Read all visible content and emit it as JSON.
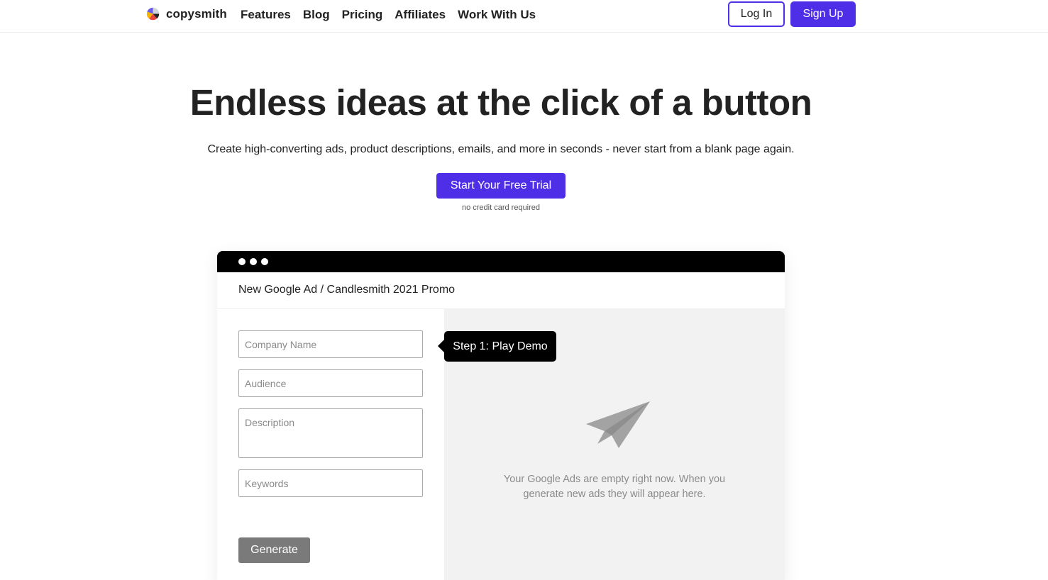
{
  "nav": {
    "logo_text": "copysmith",
    "links": [
      "Features",
      "Blog",
      "Pricing",
      "Affiliates",
      "Work With Us"
    ],
    "login_label": "Log In",
    "signup_label": "Sign Up"
  },
  "hero": {
    "title": "Endless ideas at the click of a button",
    "subtitle": "Create high-converting ads, product descriptions, emails, and more in seconds - never start from a blank page again.",
    "cta_label": "Start Your Free Trial",
    "cta_note": "no credit card required"
  },
  "demo": {
    "breadcrumb": "New Google Ad / Candlesmith 2021 Promo",
    "fields": {
      "company_placeholder": "Company Name",
      "audience_placeholder": "Audience",
      "description_placeholder": "Description",
      "keywords_placeholder": "Keywords"
    },
    "generate_label": "Generate",
    "empty_message": "Your Google Ads are empty right now. When you generate new ads they will appear here.",
    "tooltip": "Step 1: Play Demo"
  },
  "colors": {
    "accent": "#4f2ee8",
    "text": "#222222",
    "muted": "#8a8a8a",
    "panel_bg": "#f2f2f2",
    "generate_bg": "#7a7a7a"
  },
  "icons": {
    "logo": "copysmith-logo-icon",
    "plane": "paper-plane-icon"
  }
}
